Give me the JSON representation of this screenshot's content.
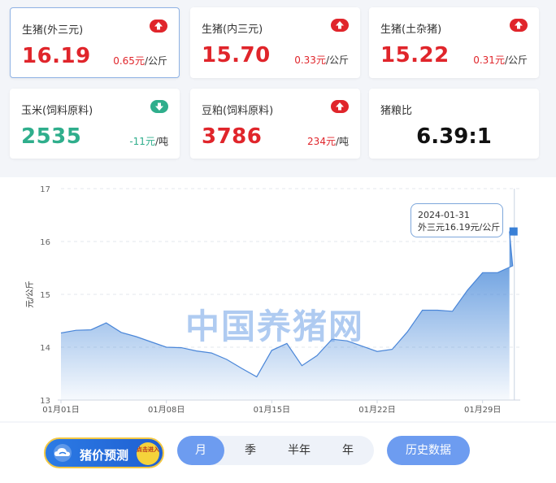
{
  "cards": [
    {
      "name": "生猪(外三元)",
      "value": "16.19",
      "change": "0.65元",
      "unit": "/公斤",
      "trend": "up"
    },
    {
      "name": "生猪(内三元)",
      "value": "15.70",
      "change": "0.33元",
      "unit": "/公斤",
      "trend": "up"
    },
    {
      "name": "生猪(土杂猪)",
      "value": "15.22",
      "change": "0.31元",
      "unit": "/公斤",
      "trend": "up"
    },
    {
      "name": "玉米(饲料原料)",
      "value": "2535",
      "change": "-11元",
      "unit": "/吨",
      "trend": "down"
    },
    {
      "name": "豆粕(饲料原料)",
      "value": "3786",
      "change": "234元",
      "unit": "/吨",
      "trend": "up"
    },
    {
      "name": "猪粮比",
      "value": "6.39:1"
    }
  ],
  "colors": {
    "up": "#e0252b",
    "down": "#2fae8c",
    "line": "#3a80d6",
    "accent": "#6d9cf0"
  },
  "watermark": "中国养猪网",
  "tooltip": {
    "date": "2024-01-31",
    "text": "外三元16.19元/公斤"
  },
  "chart_data": {
    "type": "area",
    "ylabel": "元/公斤",
    "ylim": [
      13,
      17
    ],
    "yticks": [
      13,
      14,
      15,
      16,
      17
    ],
    "xticks": [
      {
        "day": 1,
        "label": "01月01日"
      },
      {
        "day": 8,
        "label": "01月08日"
      },
      {
        "day": 15,
        "label": "01月15日"
      },
      {
        "day": 22,
        "label": "01月22日"
      },
      {
        "day": 29,
        "label": "01月29日"
      }
    ],
    "series": [
      {
        "x": [
          1,
          2,
          3,
          4,
          5,
          6,
          7,
          8,
          9,
          10,
          11,
          12,
          13,
          14,
          15,
          16,
          17,
          18,
          19,
          20,
          21,
          22,
          23,
          24,
          25,
          26,
          27,
          28,
          29,
          30,
          31
        ],
        "y": [
          14.27,
          14.32,
          14.33,
          14.46,
          14.28,
          14.2,
          14.1,
          14.0,
          13.99,
          13.93,
          13.89,
          13.77,
          13.6,
          13.44,
          13.94,
          14.07,
          13.65,
          13.84,
          14.15,
          14.12,
          14.02,
          13.92,
          13.96,
          14.29,
          14.7,
          14.7,
          14.68,
          15.08,
          15.41,
          15.41,
          15.54
        ]
      }
    ],
    "highlight": {
      "x": 31,
      "y": 16.19
    },
    "grid": true
  },
  "controls": {
    "promo_label": "猪价预测",
    "promo_badge": "点击进入",
    "periods": [
      "月",
      "季",
      "半年",
      "年"
    ],
    "history_label": "历史数据"
  }
}
